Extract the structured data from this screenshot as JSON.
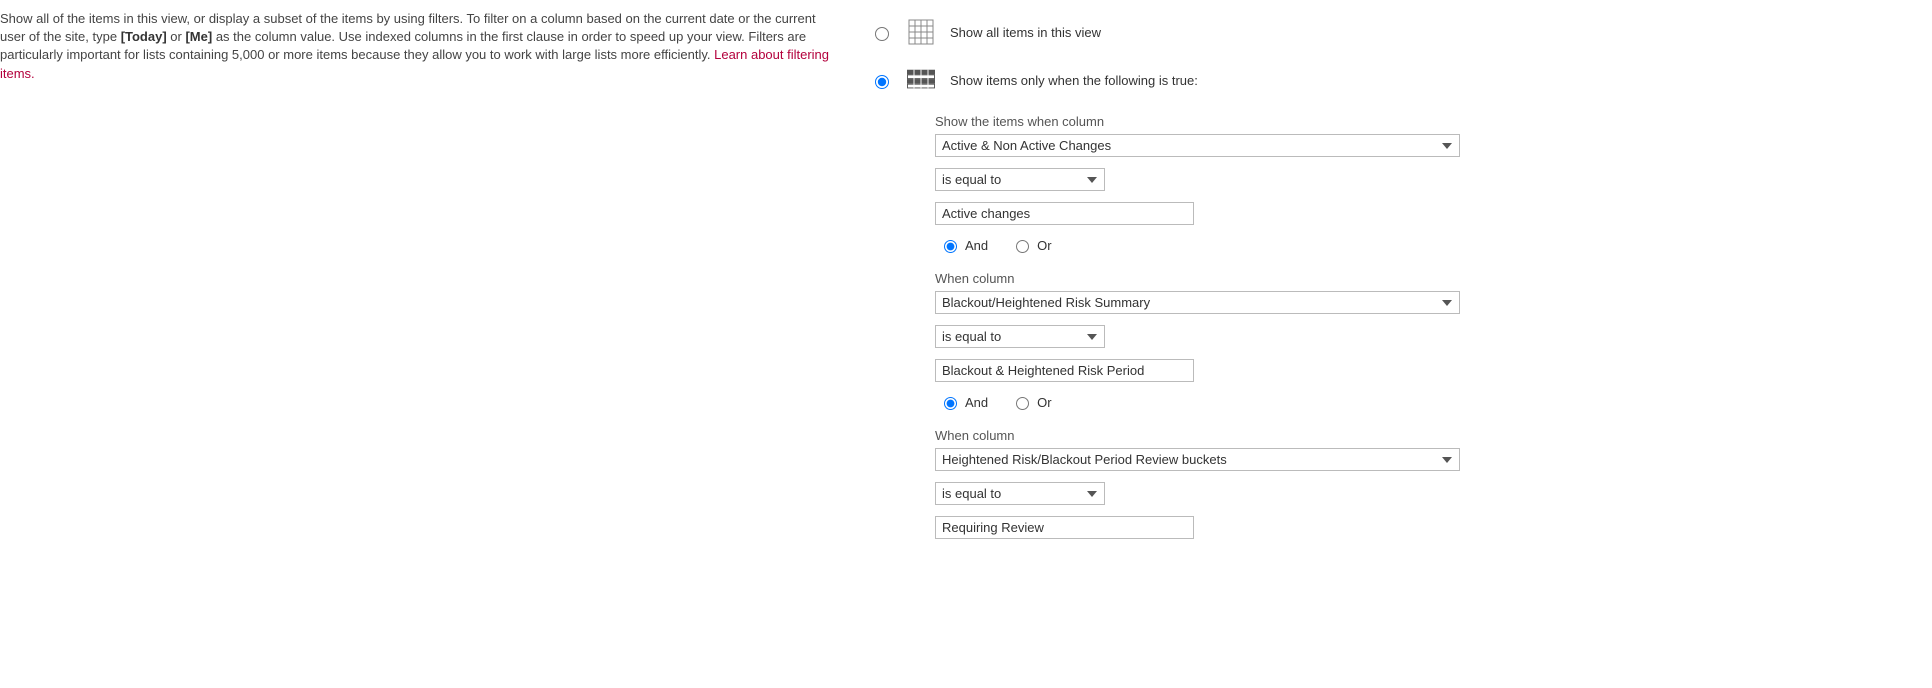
{
  "help": {
    "text_prefix": "Show all of the items in this view, or display a subset of the items by using filters. To filter on a column based on the current date or the current user of the site, type ",
    "token1": "[Today]",
    "text_mid1": " or ",
    "token2": "[Me]",
    "text_mid2": " as the column value. Use indexed columns in the first clause in order to speed up your view. Filters are particularly important for lists containing 5,000 or more items because they allow you to work with large lists more efficiently. ",
    "learn_link": "Learn about filtering items."
  },
  "options": {
    "show_all": "Show all of the items in this view, or display a subset of the items by using filters.",
    "show_all_label": "Show all items in this view",
    "show_filtered_label": "Show items only when the following is true:",
    "selected": "filtered"
  },
  "filters": [
    {
      "intro": "Show the items when column",
      "column": "Active & Non Active Changes",
      "operator": "is equal to",
      "value": "Active changes",
      "conjunction": "And"
    },
    {
      "intro": "When column",
      "column": "Blackout/Heightened Risk Summary",
      "operator": "is equal to",
      "value": "Blackout & Heightened Risk Period",
      "conjunction": "And"
    },
    {
      "intro": "When column",
      "column": "Heightened Risk/Blackout Period Review buckets",
      "operator": "is equal to",
      "value": "Requiring Review",
      "conjunction": null
    }
  ],
  "labels": {
    "and": "And",
    "or": "Or"
  }
}
